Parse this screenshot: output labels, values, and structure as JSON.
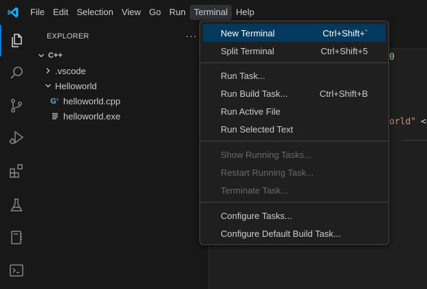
{
  "menubar": {
    "items": [
      {
        "label": "File"
      },
      {
        "label": "Edit"
      },
      {
        "label": "Selection"
      },
      {
        "label": "View"
      },
      {
        "label": "Go"
      },
      {
        "label": "Run"
      },
      {
        "label": "Terminal"
      },
      {
        "label": "Help"
      }
    ],
    "active": "Terminal"
  },
  "activitybar": {
    "items": [
      {
        "icon": "explorer-icon",
        "active": true
      },
      {
        "icon": "search-icon"
      },
      {
        "icon": "source-control-icon"
      },
      {
        "icon": "run-debug-icon"
      },
      {
        "icon": "extensions-icon"
      },
      {
        "icon": "testing-icon"
      },
      {
        "icon": "notebook-icon"
      },
      {
        "icon": "terminal-panel-icon"
      }
    ]
  },
  "sidebar": {
    "title": "EXPLORER",
    "more": "···",
    "workspace": "C++",
    "tree": [
      {
        "label": ".vscode",
        "type": "folder",
        "expanded": false
      },
      {
        "label": "Helloworld",
        "type": "folder",
        "expanded": true
      },
      {
        "label": "helloworld.cpp",
        "type": "file",
        "icon": "cpp-file-icon"
      },
      {
        "label": "helloworld.exe",
        "type": "file",
        "icon": "binary-file-icon"
      }
    ]
  },
  "editor": {
    "fragments": {
      "top": "0",
      "string": "orld\"",
      "op": "<<"
    }
  },
  "terminal_menu": {
    "groups": [
      [
        {
          "label": "New Terminal",
          "shortcut": "Ctrl+Shift+`",
          "highlighted": true
        },
        {
          "label": "Split Terminal",
          "shortcut": "Ctrl+Shift+5"
        }
      ],
      [
        {
          "label": "Run Task..."
        },
        {
          "label": "Run Build Task...",
          "shortcut": "Ctrl+Shift+B"
        },
        {
          "label": "Run Active File"
        },
        {
          "label": "Run Selected Text"
        }
      ],
      [
        {
          "label": "Show Running Tasks...",
          "disabled": true
        },
        {
          "label": "Restart Running Task...",
          "disabled": true
        },
        {
          "label": "Terminate Task...",
          "disabled": true
        }
      ],
      [
        {
          "label": "Configure Tasks..."
        },
        {
          "label": "Configure Default Build Task..."
        }
      ]
    ]
  },
  "colors": {
    "accent": "#0078d4",
    "highlight": "#04395e",
    "logo_blue": "#23a9f2",
    "cpp_icon": "#519aba",
    "string": "#ce9178"
  }
}
